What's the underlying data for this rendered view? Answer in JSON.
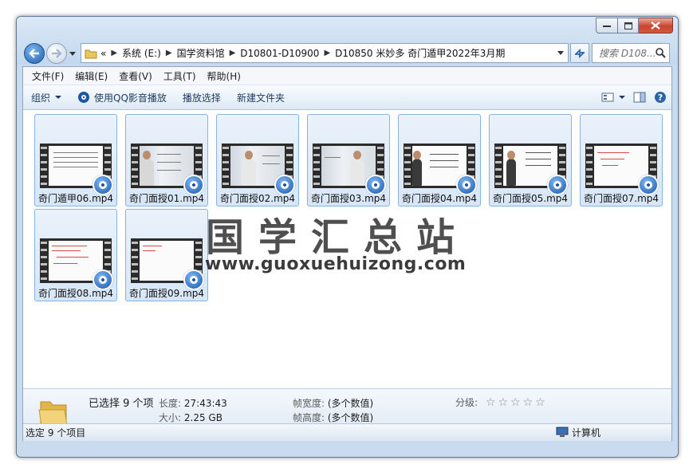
{
  "window": {
    "caption_buttons": [
      "minimize-icon",
      "maximize-icon",
      "close-icon"
    ]
  },
  "nav": {
    "address_prefix": "«",
    "breadcrumbs": [
      "系统 (E:)",
      "国学资料馆",
      "D10801-D10900",
      "D10850 米妙多 奇门遁甲2022年3月期"
    ],
    "search_placeholder": "搜索 D108..."
  },
  "menu": [
    "文件(F)",
    "编辑(E)",
    "查看(V)",
    "工具(T)",
    "帮助(H)"
  ],
  "toolbar": {
    "organize": "组织",
    "play_qq": "使用QQ影音播放",
    "play_selection": "播放选择",
    "new_folder": "新建文件夹"
  },
  "files": [
    {
      "name": "奇门遁甲06.mp4",
      "thumb": "table"
    },
    {
      "name": "奇门面授01.mp4",
      "thumb": "board"
    },
    {
      "name": "奇门面授02.mp4",
      "thumb": "person"
    },
    {
      "name": "奇门面授03.mp4",
      "thumb": "person"
    },
    {
      "name": "奇门面授04.mp4",
      "thumb": "person-left"
    },
    {
      "name": "奇门面授05.mp4",
      "thumb": "person-left"
    },
    {
      "name": "奇门面授07.mp4",
      "thumb": "red"
    },
    {
      "name": "奇门面授08.mp4",
      "thumb": "red"
    },
    {
      "name": "奇门面授09.mp4",
      "thumb": "red-small"
    }
  ],
  "watermark": {
    "text": "国学汇总站",
    "url": "www.guoxuehuizong.com"
  },
  "details": {
    "selected": "已选择 9 个项",
    "length_label": "长度:",
    "length_value": "27:43:43",
    "size_label": "大小:",
    "size_value": "2.25 GB",
    "frame_width_label": "帧宽度:",
    "frame_width_value": "(多个数值)",
    "frame_height_label": "帧高度:",
    "frame_height_value": "(多个数值)",
    "rating_label": "分级:",
    "rating_stars": 0
  },
  "status": {
    "left": "选定 9 个项目",
    "right": "计算机"
  }
}
